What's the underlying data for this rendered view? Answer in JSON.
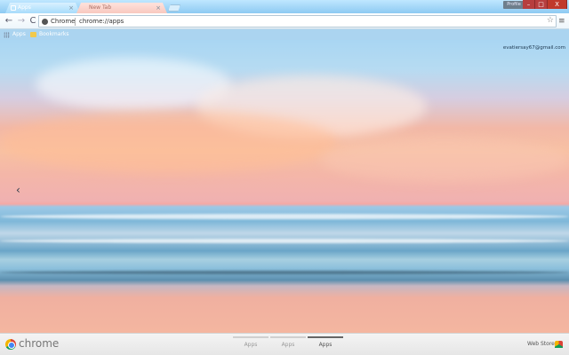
{
  "tabs": [
    {
      "label": "Apps",
      "active": true
    },
    {
      "label": "New Tab",
      "active": false
    }
  ],
  "window": {
    "profile_label": "Profile",
    "minimize": "–",
    "maximize": "□",
    "close": "X"
  },
  "toolbar": {
    "back": "←",
    "forward": "→",
    "reload": "C",
    "omnibox_chip": "Chrome",
    "url": "chrome://apps",
    "star": "☆",
    "menu": "≡"
  },
  "bookmarks": [
    {
      "label": "Apps",
      "icon": "apps-grid-icon"
    },
    {
      "label": "Bookmarks",
      "icon": "folder-icon"
    }
  ],
  "account": {
    "email": "evatiersay67@gmail.com"
  },
  "scene": {
    "prev_arrow": "‹"
  },
  "footer": {
    "brand": "chrome",
    "pages": [
      {
        "label": "Apps",
        "active": false
      },
      {
        "label": "Apps",
        "active": false
      },
      {
        "label": "Apps",
        "active": true
      }
    ],
    "webstore_label": "Web Store"
  },
  "colors": {
    "accent": "#8dcaf2",
    "window_controls": "#b73e3e"
  }
}
